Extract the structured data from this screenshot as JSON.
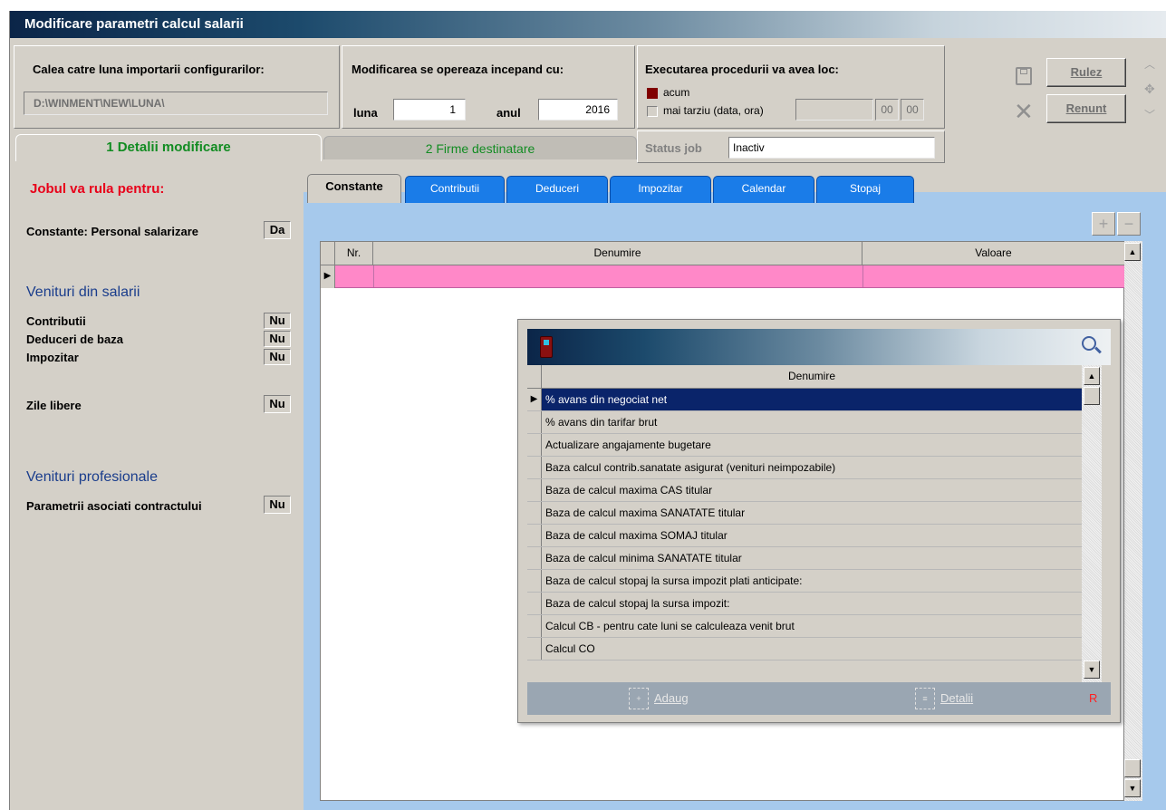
{
  "window": {
    "title": "Modificare parametri calcul salarii"
  },
  "config_path": {
    "label": "Calea catre luna importarii configurarilor:",
    "value": "D:\\WINMENT\\NEW\\LUNA\\"
  },
  "start": {
    "label": "Modificarea se opereaza incepand cu:",
    "luna_label": "luna",
    "luna_value": "1",
    "anul_label": "anul",
    "anul_value": "2016"
  },
  "execution": {
    "label": "Executarea procedurii va avea loc:",
    "now_label": "acum",
    "later_label": "mai tarziu (data, ora)",
    "hour": "00",
    "minute": "00"
  },
  "status": {
    "label": "Status job",
    "value": "Inactiv"
  },
  "buttons": {
    "run": "Rulez",
    "cancel": "Renunt"
  },
  "tabs": {
    "tab1": "1 Detalii modificare",
    "tab2": "2 Firme destinatare"
  },
  "left": {
    "heading": "Jobul va rula pentru:",
    "constante_label": "Constante: Personal salarizare",
    "constante_value": "Da",
    "section1": "Venituri din salarii",
    "items": [
      {
        "label": "Contributii",
        "value": "Nu"
      },
      {
        "label": "Deduceri de baza",
        "value": "Nu"
      },
      {
        "label": "Impozitar",
        "value": "Nu"
      }
    ],
    "zile_label": "Zile libere",
    "zile_value": "Nu",
    "section2": "Venituri profesionale",
    "param_label": "Parametrii asociati contractului",
    "param_value": "Nu"
  },
  "inner_tabs": [
    "Constante",
    "Contributii",
    "Deduceri",
    "Impozitar",
    "Calendar",
    "Stopaj"
  ],
  "grid": {
    "col_nr": "Nr.",
    "col_denumire": "Denumire",
    "col_valoare": "Valoare"
  },
  "popup": {
    "column": "Denumire",
    "rows": [
      "% avans din negociat net",
      "% avans din tarifar brut",
      "Actualizare angajamente bugetare",
      "Baza calcul contrib.sanatate asigurat (venituri neimpozabile)",
      "Baza de calcul maxima CAS titular",
      "Baza de calcul maxima SANATATE titular",
      "Baza de calcul maxima SOMAJ titular",
      "Baza de calcul minima SANATATE titular",
      "Baza de calcul stopaj la sursa impozit plati anticipate:",
      "Baza de calcul stopaj la sursa impozit:",
      "Calcul CB - pentru cate luni se calculeaza venit brut",
      "Calcul CO"
    ],
    "add_label": "Adaug",
    "details_label": "Detalii",
    "r_label": "R"
  },
  "colors": {
    "accent_green": "#128c22",
    "heading_red": "#e8001a",
    "section_blue": "#1a3d8c",
    "tab_blue": "#1a7ce8",
    "selected_row": "#ff88c8"
  }
}
